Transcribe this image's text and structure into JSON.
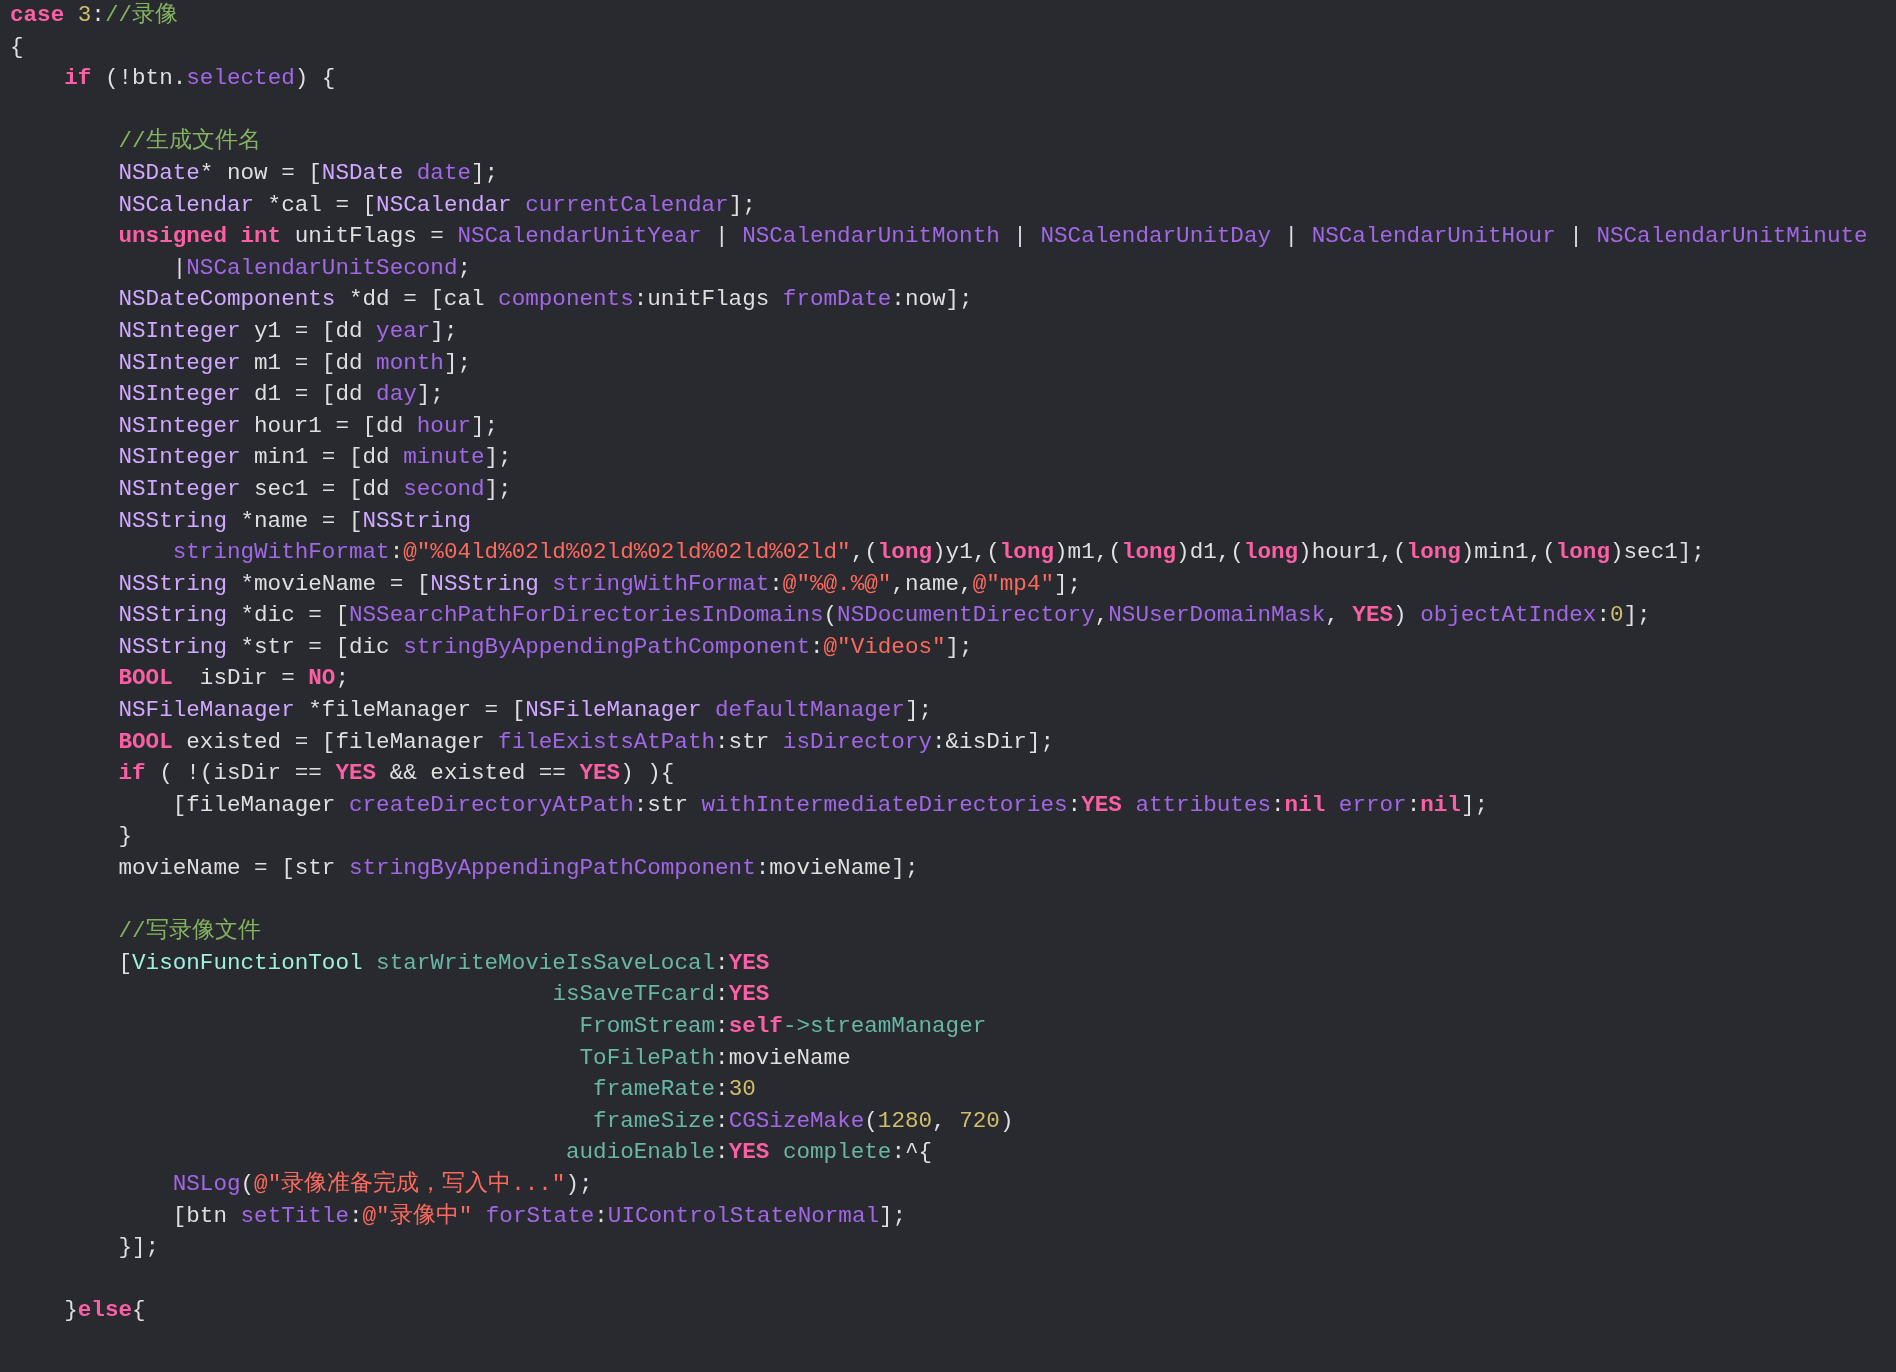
{
  "editor": {
    "lines": [
      {
        "kind": "code",
        "tokens": [
          {
            "text": "case",
            "kind": "keyword"
          },
          {
            "text": " 3",
            "kind": "number"
          },
          {
            "text": ":",
            "kind": "plain"
          },
          {
            "text": "//录像",
            "kind": "comment"
          }
        ]
      },
      {
        "kind": "code",
        "tokens": [
          {
            "text": "{",
            "kind": "plain"
          }
        ]
      },
      {
        "kind": "code",
        "tokens": [
          {
            "text": "    if",
            "kind": "keyword"
          },
          {
            "text": " (!btn.",
            "kind": "plain"
          },
          {
            "text": "selected",
            "kind": "system"
          },
          {
            "text": ") {",
            "kind": "plain"
          }
        ]
      },
      {
        "kind": "blank"
      },
      {
        "kind": "code",
        "tokens": [
          {
            "text": "        //生成文件名",
            "kind": "comment"
          }
        ]
      },
      {
        "kind": "code",
        "tokens": [
          {
            "text": "        NSDate",
            "kind": "type"
          },
          {
            "text": "* now = [",
            "kind": "plain"
          },
          {
            "text": "NSDate",
            "kind": "type"
          },
          {
            "text": " date",
            "kind": "system"
          },
          {
            "text": "];",
            "kind": "plain"
          }
        ]
      },
      {
        "kind": "code",
        "tokens": [
          {
            "text": "        NSCalendar",
            "kind": "type"
          },
          {
            "text": " *cal = [",
            "kind": "plain"
          },
          {
            "text": "NSCalendar",
            "kind": "type"
          },
          {
            "text": " currentCalendar",
            "kind": "system"
          },
          {
            "text": "];",
            "kind": "plain"
          }
        ]
      },
      {
        "kind": "code",
        "tokens": [
          {
            "text": "        unsigned",
            "kind": "keyword"
          },
          {
            "text": " int",
            "kind": "keyword"
          },
          {
            "text": " unitFlags = ",
            "kind": "plain"
          },
          {
            "text": "NSCalendarUnitYear",
            "kind": "system"
          },
          {
            "text": " | ",
            "kind": "plain"
          },
          {
            "text": "NSCalendarUnitMonth",
            "kind": "system"
          },
          {
            "text": " | ",
            "kind": "plain"
          },
          {
            "text": "NSCalendarUnitDay",
            "kind": "system"
          },
          {
            "text": " | ",
            "kind": "plain"
          },
          {
            "text": "NSCalendarUnitHour",
            "kind": "system"
          },
          {
            "text": " | ",
            "kind": "plain"
          },
          {
            "text": "NSCalendarUnitMinute",
            "kind": "system"
          }
        ]
      },
      {
        "kind": "code",
        "tokens": [
          {
            "text": "            |",
            "kind": "plain"
          },
          {
            "text": "NSCalendarUnitSecond",
            "kind": "system"
          },
          {
            "text": ";",
            "kind": "plain"
          }
        ]
      },
      {
        "kind": "code",
        "tokens": [
          {
            "text": "        NSDateComponents",
            "kind": "type"
          },
          {
            "text": " *dd = [cal ",
            "kind": "plain"
          },
          {
            "text": "components",
            "kind": "system"
          },
          {
            "text": ":unitFlags ",
            "kind": "plain"
          },
          {
            "text": "fromDate",
            "kind": "system"
          },
          {
            "text": ":now];",
            "kind": "plain"
          }
        ]
      },
      {
        "kind": "code",
        "tokens": [
          {
            "text": "        NSInteger",
            "kind": "type"
          },
          {
            "text": " y1 = [dd ",
            "kind": "plain"
          },
          {
            "text": "year",
            "kind": "system"
          },
          {
            "text": "];",
            "kind": "plain"
          }
        ]
      },
      {
        "kind": "code",
        "tokens": [
          {
            "text": "        NSInteger",
            "kind": "type"
          },
          {
            "text": " m1 = [dd ",
            "kind": "plain"
          },
          {
            "text": "month",
            "kind": "system"
          },
          {
            "text": "];",
            "kind": "plain"
          }
        ]
      },
      {
        "kind": "code",
        "tokens": [
          {
            "text": "        NSInteger",
            "kind": "type"
          },
          {
            "text": " d1 = [dd ",
            "kind": "plain"
          },
          {
            "text": "day",
            "kind": "system"
          },
          {
            "text": "];",
            "kind": "plain"
          }
        ]
      },
      {
        "kind": "code",
        "tokens": [
          {
            "text": "        NSInteger",
            "kind": "type"
          },
          {
            "text": " hour1 = [dd ",
            "kind": "plain"
          },
          {
            "text": "hour",
            "kind": "system"
          },
          {
            "text": "];",
            "kind": "plain"
          }
        ]
      },
      {
        "kind": "code",
        "tokens": [
          {
            "text": "        NSInteger",
            "kind": "type"
          },
          {
            "text": " min1 = [dd ",
            "kind": "plain"
          },
          {
            "text": "minute",
            "kind": "system"
          },
          {
            "text": "];",
            "kind": "plain"
          }
        ]
      },
      {
        "kind": "code",
        "tokens": [
          {
            "text": "        NSInteger",
            "kind": "type"
          },
          {
            "text": " sec1 = [dd ",
            "kind": "plain"
          },
          {
            "text": "second",
            "kind": "system"
          },
          {
            "text": "];",
            "kind": "plain"
          }
        ]
      },
      {
        "kind": "code",
        "tokens": [
          {
            "text": "        NSString",
            "kind": "type"
          },
          {
            "text": " *name = [",
            "kind": "plain"
          },
          {
            "text": "NSString",
            "kind": "type"
          }
        ]
      },
      {
        "kind": "code",
        "tokens": [
          {
            "text": "            stringWithFormat",
            "kind": "system"
          },
          {
            "text": ":",
            "kind": "plain"
          },
          {
            "text": "@\"%04ld%02ld%02ld%02ld%02ld%02ld\"",
            "kind": "string"
          },
          {
            "text": ",(",
            "kind": "plain"
          },
          {
            "text": "long",
            "kind": "keyword"
          },
          {
            "text": ")y1,(",
            "kind": "plain"
          },
          {
            "text": "long",
            "kind": "keyword"
          },
          {
            "text": ")m1,(",
            "kind": "plain"
          },
          {
            "text": "long",
            "kind": "keyword"
          },
          {
            "text": ")d1,(",
            "kind": "plain"
          },
          {
            "text": "long",
            "kind": "keyword"
          },
          {
            "text": ")hour1,(",
            "kind": "plain"
          },
          {
            "text": "long",
            "kind": "keyword"
          },
          {
            "text": ")min1,(",
            "kind": "plain"
          },
          {
            "text": "long",
            "kind": "keyword"
          },
          {
            "text": ")sec1];",
            "kind": "plain"
          }
        ]
      },
      {
        "kind": "code",
        "tokens": [
          {
            "text": "        NSString",
            "kind": "type"
          },
          {
            "text": " *movieName = [",
            "kind": "plain"
          },
          {
            "text": "NSString",
            "kind": "type"
          },
          {
            "text": " stringWithFormat",
            "kind": "system"
          },
          {
            "text": ":",
            "kind": "plain"
          },
          {
            "text": "@\"%@.%@\"",
            "kind": "string"
          },
          {
            "text": ",name,",
            "kind": "plain"
          },
          {
            "text": "@\"mp4\"",
            "kind": "string"
          },
          {
            "text": "];",
            "kind": "plain"
          }
        ]
      },
      {
        "kind": "code",
        "tokens": [
          {
            "text": "        NSString",
            "kind": "type"
          },
          {
            "text": " *dic = [",
            "kind": "plain"
          },
          {
            "text": "NSSearchPathForDirectoriesInDomains",
            "kind": "system"
          },
          {
            "text": "(",
            "kind": "plain"
          },
          {
            "text": "NSDocumentDirectory",
            "kind": "system"
          },
          {
            "text": ",",
            "kind": "plain"
          },
          {
            "text": "NSUserDomainMask",
            "kind": "system"
          },
          {
            "text": ", ",
            "kind": "plain"
          },
          {
            "text": "YES",
            "kind": "keyword"
          },
          {
            "text": ") ",
            "kind": "plain"
          },
          {
            "text": "objectAtIndex",
            "kind": "system"
          },
          {
            "text": ":",
            "kind": "plain"
          },
          {
            "text": "0",
            "kind": "number"
          },
          {
            "text": "];",
            "kind": "plain"
          }
        ]
      },
      {
        "kind": "code",
        "tokens": [
          {
            "text": "        NSString",
            "kind": "type"
          },
          {
            "text": " *str = [dic ",
            "kind": "plain"
          },
          {
            "text": "stringByAppendingPathComponent",
            "kind": "system"
          },
          {
            "text": ":",
            "kind": "plain"
          },
          {
            "text": "@\"Videos\"",
            "kind": "string"
          },
          {
            "text": "];",
            "kind": "plain"
          }
        ]
      },
      {
        "kind": "code",
        "tokens": [
          {
            "text": "        BOOL",
            "kind": "keyword"
          },
          {
            "text": "  isDir = ",
            "kind": "plain"
          },
          {
            "text": "NO",
            "kind": "keyword"
          },
          {
            "text": ";",
            "kind": "plain"
          }
        ]
      },
      {
        "kind": "code",
        "tokens": [
          {
            "text": "        NSFileManager",
            "kind": "type"
          },
          {
            "text": " *fileManager = [",
            "kind": "plain"
          },
          {
            "text": "NSFileManager",
            "kind": "type"
          },
          {
            "text": " defaultManager",
            "kind": "system"
          },
          {
            "text": "];",
            "kind": "plain"
          }
        ]
      },
      {
        "kind": "code",
        "tokens": [
          {
            "text": "        BOOL",
            "kind": "keyword"
          },
          {
            "text": " existed = [fileManager ",
            "kind": "plain"
          },
          {
            "text": "fileExistsAtPath",
            "kind": "system"
          },
          {
            "text": ":str ",
            "kind": "plain"
          },
          {
            "text": "isDirectory",
            "kind": "system"
          },
          {
            "text": ":&isDir];",
            "kind": "plain"
          }
        ]
      },
      {
        "kind": "code",
        "tokens": [
          {
            "text": "        if",
            "kind": "keyword"
          },
          {
            "text": " ( !(isDir == ",
            "kind": "plain"
          },
          {
            "text": "YES",
            "kind": "keyword"
          },
          {
            "text": " && existed == ",
            "kind": "plain"
          },
          {
            "text": "YES",
            "kind": "keyword"
          },
          {
            "text": ") ){",
            "kind": "plain"
          }
        ]
      },
      {
        "kind": "code",
        "tokens": [
          {
            "text": "            [fileManager ",
            "kind": "plain"
          },
          {
            "text": "createDirectoryAtPath",
            "kind": "system"
          },
          {
            "text": ":str ",
            "kind": "plain"
          },
          {
            "text": "withIntermediateDirectories",
            "kind": "system"
          },
          {
            "text": ":",
            "kind": "plain"
          },
          {
            "text": "YES",
            "kind": "keyword"
          },
          {
            "text": " attributes",
            "kind": "system"
          },
          {
            "text": ":",
            "kind": "plain"
          },
          {
            "text": "nil",
            "kind": "keyword"
          },
          {
            "text": " error",
            "kind": "system"
          },
          {
            "text": ":",
            "kind": "plain"
          },
          {
            "text": "nil",
            "kind": "keyword"
          },
          {
            "text": "];",
            "kind": "plain"
          }
        ]
      },
      {
        "kind": "code",
        "tokens": [
          {
            "text": "        }",
            "kind": "plain"
          }
        ]
      },
      {
        "kind": "code",
        "tokens": [
          {
            "text": "        movieName = [str ",
            "kind": "plain"
          },
          {
            "text": "stringByAppendingPathComponent",
            "kind": "system"
          },
          {
            "text": ":movieName];",
            "kind": "plain"
          }
        ]
      },
      {
        "kind": "blank"
      },
      {
        "kind": "code",
        "tokens": [
          {
            "text": "        //写录像文件",
            "kind": "comment"
          }
        ]
      },
      {
        "kind": "code",
        "tokens": [
          {
            "text": "        [",
            "kind": "plain"
          },
          {
            "text": "VisonFunctionTool",
            "kind": "project_type"
          },
          {
            "text": " starWriteMovieIsSaveLocal",
            "kind": "project_method"
          },
          {
            "text": ":",
            "kind": "plain"
          },
          {
            "text": "YES",
            "kind": "keyword"
          }
        ]
      },
      {
        "kind": "code",
        "tokens": [
          {
            "text": "                                        isSaveTFcard",
            "kind": "project_method"
          },
          {
            "text": ":",
            "kind": "plain"
          },
          {
            "text": "YES",
            "kind": "keyword"
          }
        ]
      },
      {
        "kind": "code",
        "tokens": [
          {
            "text": "                                          FromStream",
            "kind": "project_method"
          },
          {
            "text": ":",
            "kind": "plain"
          },
          {
            "text": "self",
            "kind": "keyword"
          },
          {
            "text": "->streamManager",
            "kind": "project_method"
          }
        ]
      },
      {
        "kind": "code",
        "tokens": [
          {
            "text": "                                          ToFilePath",
            "kind": "project_method"
          },
          {
            "text": ":movieName",
            "kind": "plain"
          }
        ]
      },
      {
        "kind": "code",
        "tokens": [
          {
            "text": "                                           frameRate",
            "kind": "project_method"
          },
          {
            "text": ":",
            "kind": "plain"
          },
          {
            "text": "30",
            "kind": "number"
          }
        ]
      },
      {
        "kind": "code",
        "tokens": [
          {
            "text": "                                           frameSize",
            "kind": "project_method"
          },
          {
            "text": ":",
            "kind": "plain"
          },
          {
            "text": "CGSizeMake",
            "kind": "system"
          },
          {
            "text": "(",
            "kind": "plain"
          },
          {
            "text": "1280",
            "kind": "number"
          },
          {
            "text": ", ",
            "kind": "plain"
          },
          {
            "text": "720",
            "kind": "number"
          },
          {
            "text": ")",
            "kind": "plain"
          }
        ]
      },
      {
        "kind": "code",
        "tokens": [
          {
            "text": "                                         audioEnable",
            "kind": "project_method"
          },
          {
            "text": ":",
            "kind": "plain"
          },
          {
            "text": "YES",
            "kind": "keyword"
          },
          {
            "text": " complete",
            "kind": "project_method"
          },
          {
            "text": ":^{",
            "kind": "plain"
          }
        ]
      },
      {
        "kind": "code",
        "tokens": [
          {
            "text": "            NSLog",
            "kind": "system"
          },
          {
            "text": "(",
            "kind": "plain"
          },
          {
            "text": "@\"录像准备完成，写入中...\"",
            "kind": "string"
          },
          {
            "text": ");",
            "kind": "plain"
          }
        ]
      },
      {
        "kind": "code",
        "tokens": [
          {
            "text": "            [btn ",
            "kind": "plain"
          },
          {
            "text": "setTitle",
            "kind": "system"
          },
          {
            "text": ":",
            "kind": "plain"
          },
          {
            "text": "@\"录像中\"",
            "kind": "string"
          },
          {
            "text": " forState",
            "kind": "system"
          },
          {
            "text": ":",
            "kind": "plain"
          },
          {
            "text": "UIControlStateNormal",
            "kind": "system"
          },
          {
            "text": "];",
            "kind": "plain"
          }
        ]
      },
      {
        "kind": "code",
        "tokens": [
          {
            "text": "        }];",
            "kind": "plain"
          }
        ]
      },
      {
        "kind": "blank"
      },
      {
        "kind": "code",
        "tokens": [
          {
            "text": "    }",
            "kind": "plain"
          },
          {
            "text": "else",
            "kind": "keyword"
          },
          {
            "text": "{",
            "kind": "plain"
          }
        ]
      }
    ]
  }
}
